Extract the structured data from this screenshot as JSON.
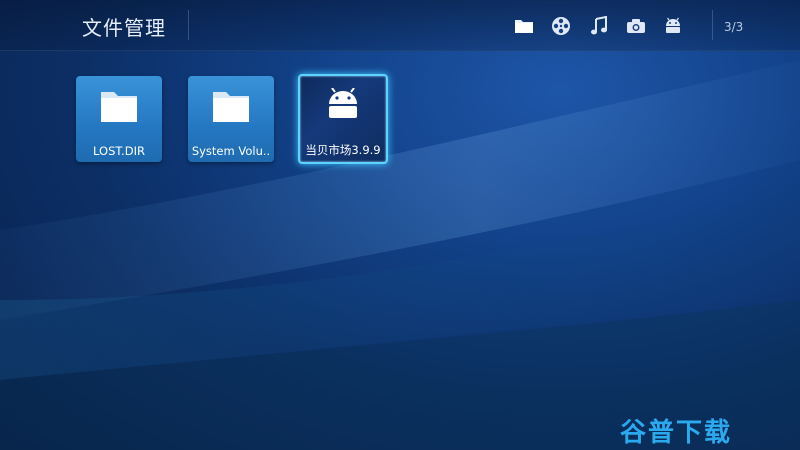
{
  "header": {
    "title": "文件管理",
    "page_indicator": "3/3",
    "tabs": [
      {
        "icon": "folder-icon"
      },
      {
        "icon": "film-reel-icon"
      },
      {
        "icon": "music-note-icon"
      },
      {
        "icon": "camera-icon"
      },
      {
        "icon": "android-icon"
      }
    ]
  },
  "grid": {
    "items": [
      {
        "label": "LOST.DIR",
        "icon": "folder-icon"
      },
      {
        "label": "System Volu..",
        "icon": "folder-icon"
      },
      {
        "label": "当贝市场3.9.9",
        "icon": "android-icon",
        "selected": true
      }
    ]
  },
  "watermark": {
    "text": "谷普下载"
  },
  "colors": {
    "accent": "#5fd3ff",
    "tile": "#2478c2",
    "watermark": "#2fb7ff"
  }
}
